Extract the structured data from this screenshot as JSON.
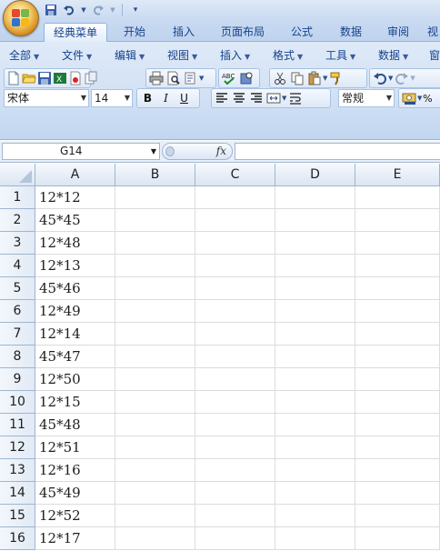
{
  "quick_access": {
    "icons": [
      "save-icon",
      "undo-icon",
      "redo-icon",
      "customize-icon"
    ]
  },
  "tabs": [
    {
      "label": "经典菜单",
      "active": true
    },
    {
      "label": "开始"
    },
    {
      "label": "插入"
    },
    {
      "label": "页面布局"
    },
    {
      "label": "公式"
    },
    {
      "label": "数据"
    },
    {
      "label": "审阅"
    },
    {
      "label": "视"
    }
  ],
  "menus": [
    "全部",
    "文件",
    "编辑",
    "视图",
    "插入",
    "格式",
    "工具",
    "数据",
    "窗"
  ],
  "font": {
    "name": "宋体",
    "size": "14"
  },
  "format_buttons": {
    "bold": "B",
    "italic": "I",
    "underline": "U"
  },
  "number_format": "常规",
  "percent": "%",
  "formula_bar": {
    "name_box": "G14",
    "fx": "fx",
    "formula": ""
  },
  "columns": [
    "A",
    "B",
    "C",
    "D",
    "E"
  ],
  "rows": [
    {
      "num": "1",
      "a": "12*12"
    },
    {
      "num": "2",
      "a": "45*45"
    },
    {
      "num": "3",
      "a": "12*48"
    },
    {
      "num": "4",
      "a": "12*13"
    },
    {
      "num": "5",
      "a": "45*46"
    },
    {
      "num": "6",
      "a": "12*49"
    },
    {
      "num": "7",
      "a": "12*14"
    },
    {
      "num": "8",
      "a": "45*47"
    },
    {
      "num": "9",
      "a": "12*50"
    },
    {
      "num": "10",
      "a": "12*15"
    },
    {
      "num": "11",
      "a": "45*48"
    },
    {
      "num": "12",
      "a": "12*51"
    },
    {
      "num": "13",
      "a": "12*16"
    },
    {
      "num": "14",
      "a": "45*49"
    },
    {
      "num": "15",
      "a": "12*52"
    },
    {
      "num": "16",
      "a": "12*17"
    }
  ],
  "colors": {
    "ribbon": "#d1e0f4",
    "tab_text": "#15428b",
    "grid_line": "#dadcdd",
    "header_border": "#9eb6ce"
  }
}
